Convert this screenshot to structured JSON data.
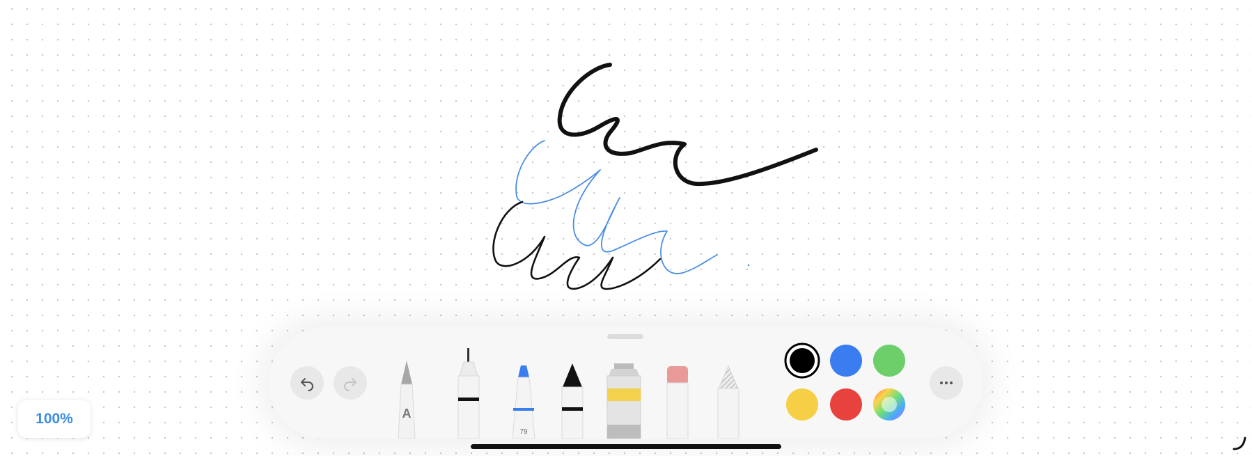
{
  "zoom": {
    "label": "100%"
  },
  "tools": {
    "text_pen_letter": "A",
    "marker_value": "79"
  },
  "colors": {
    "selected": "#000000",
    "swatches": [
      "#000000",
      "#3a7df0",
      "#6dcf6a",
      "#f7cf46",
      "#e8423e",
      "spectrum"
    ]
  },
  "icons": [
    "undo-icon",
    "redo-icon",
    "ellipsis-icon"
  ]
}
